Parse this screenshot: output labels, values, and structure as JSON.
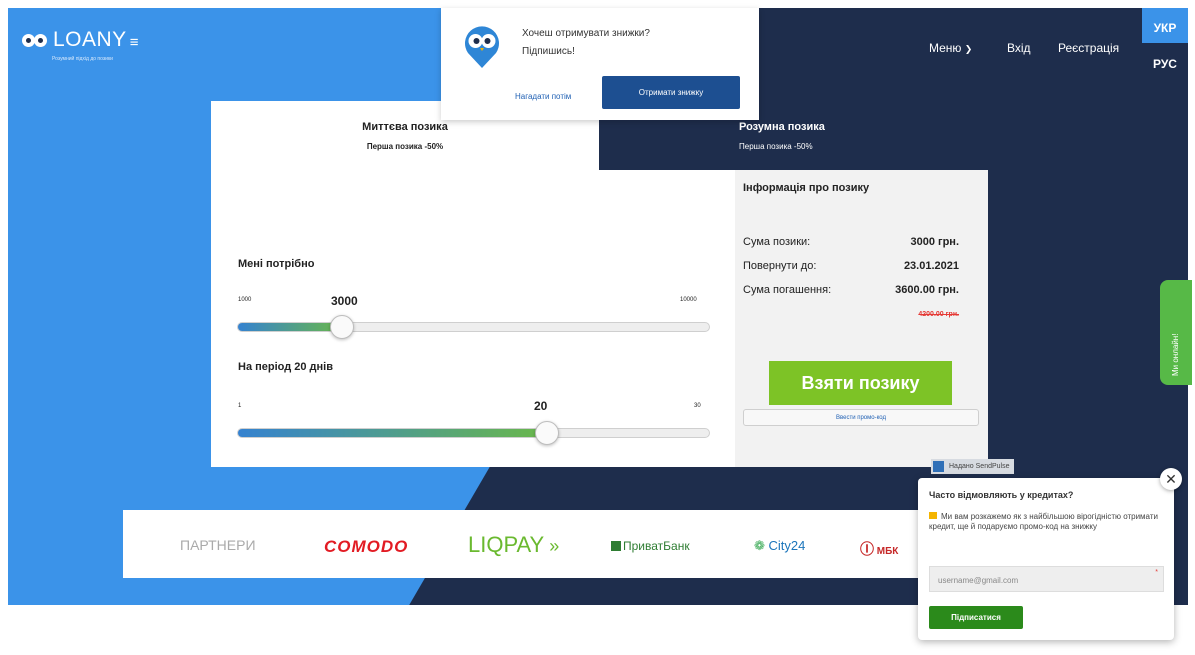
{
  "header": {
    "logo_text": "LOANY",
    "tagline": "Розумний підхід до позики",
    "nav": {
      "menu": "Меню",
      "login": "Вхід",
      "register": "Реєстрація"
    },
    "languages": {
      "active": "УКР",
      "other": "РУС"
    }
  },
  "popup": {
    "question": "Хочеш отримувати знижки?",
    "subscribe_prompt": "Підпишись!",
    "remind_later": "Нагадати потім",
    "get_discount": "Отримати знижку"
  },
  "calculator": {
    "tabs": [
      {
        "title": "Миттєва позика",
        "subtitle": "Перша позика -50%"
      },
      {
        "title": "Розумна позика",
        "subtitle": "Перша позика -50%"
      }
    ],
    "amount": {
      "label": "Мені потрібно",
      "min": "1000",
      "max": "10000",
      "current": "3000",
      "fraction": 0.222
    },
    "period": {
      "label": "На період 20 днів",
      "min": "1",
      "max": "30",
      "current": "20",
      "fraction": 0.655
    },
    "info": {
      "title": "Інформація про позику",
      "rows": [
        {
          "label": "Сума позики:",
          "value": "3000 грн."
        },
        {
          "label": "Повернути до:",
          "value": "23.01.2021"
        },
        {
          "label": "Сума погашення:",
          "value": "3600.00 грн."
        }
      ],
      "old_value": "4200.00 грн.",
      "take_button": "Взяти позику",
      "promo_button": "Ввести промо-код"
    }
  },
  "sendpulse": {
    "label": "Надано SendPulse"
  },
  "partners": {
    "label": "ПАРТНЕРИ",
    "logos": [
      "COMODO",
      "LIQPAY",
      "ПриватБанк",
      "City24",
      "МБК"
    ]
  },
  "chat_tab": {
    "label": "Ми онлайн!"
  },
  "subscribe": {
    "title": "Часто відмовляють у кредитах?",
    "text": "Ми вам розкажемо як з найбільшою вірогідністю отримати кредит, ще й подаруємо промо-код на знижку",
    "email_placeholder": "username@gmail.com",
    "required_mark": "*",
    "button": "Підписатися",
    "close_glyph": "✕"
  },
  "colors": {
    "primary_blue": "#3b93e9",
    "navy": "#1e2d4c",
    "take_green": "#7dc326",
    "subscribe_green": "#2b8a1b",
    "strike_red": "#e53935"
  },
  "icons": [
    "owl-logo-icon",
    "hamburger-icon",
    "chevron-down-icon",
    "owl-badge-icon",
    "sendpulse-icon",
    "close-icon",
    "emoji-icon"
  ]
}
